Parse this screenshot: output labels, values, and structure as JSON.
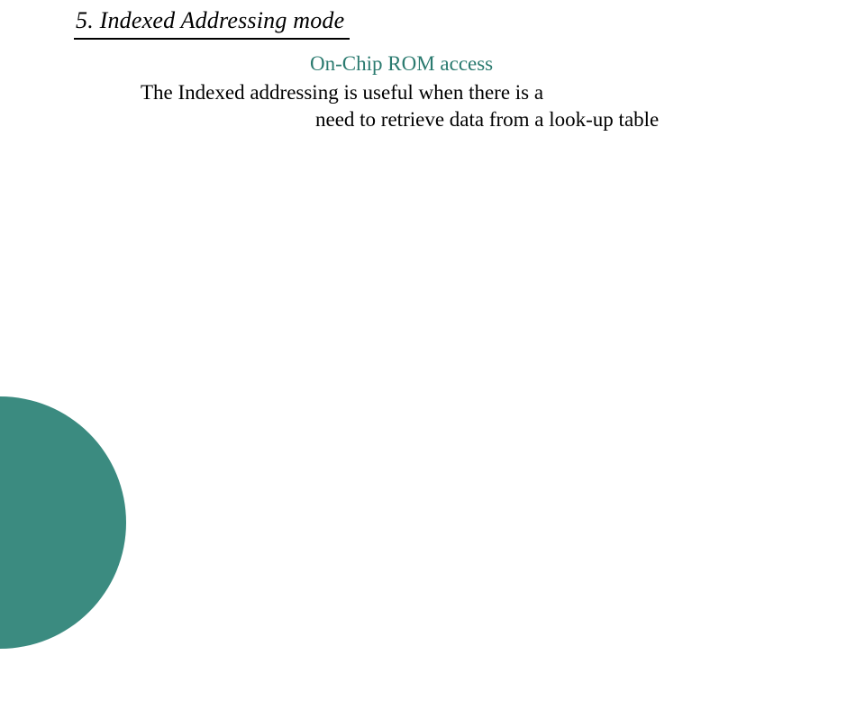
{
  "title": "5. Indexed Addressing mode",
  "body": {
    "subhead": "On-Chip ROM access",
    "line2": "The Indexed  addressing is useful when there is a",
    "line3": "need to retrieve data from a look-up table"
  },
  "colors": {
    "accent": "#2a7a6f",
    "corner": "#3b8b80"
  }
}
